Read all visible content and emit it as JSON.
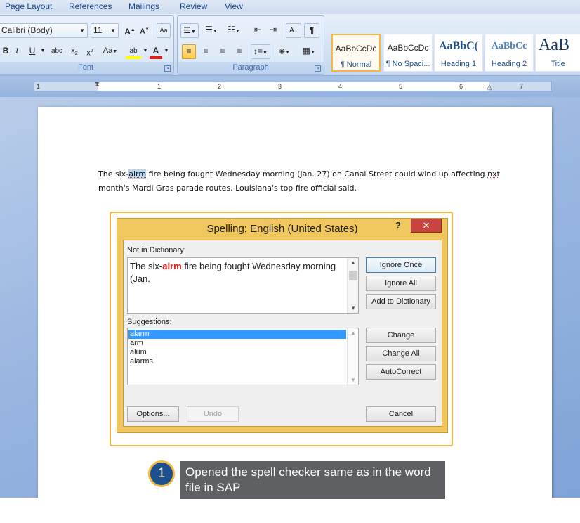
{
  "ribbon": {
    "tabs": [
      "Page Layout",
      "References",
      "Mailings",
      "Review",
      "View"
    ],
    "font": {
      "name": "Calibri (Body)",
      "size": "11",
      "group_label": "Font"
    },
    "paragraph": {
      "group_label": "Paragraph"
    },
    "styles": [
      {
        "sample": "AaBbCcDc",
        "name": "¶ Normal"
      },
      {
        "sample": "AaBbCcDc",
        "name": "¶ No Spaci..."
      },
      {
        "sample": "AaBbC(",
        "name": "Heading 1"
      },
      {
        "sample": "AaBbCc",
        "name": "Heading 2"
      },
      {
        "sample": "AaB",
        "name": "Title"
      }
    ]
  },
  "ruler": {
    "numbers": [
      "1",
      "1",
      "2",
      "3",
      "4",
      "5",
      "6",
      "7"
    ]
  },
  "document": {
    "text_before": "The six-",
    "misspelled": "alrm",
    "text_middle": " fire being fought Wednesday morning (Jan. 27) on Canal Street could wind up affecting ",
    "misspelled2": "nxt",
    "text_after": " month's Mardi Gras parade routes, Louisiana's top fire official said."
  },
  "dialog": {
    "title": "Spelling: English (United States)",
    "help": "?",
    "close": "✕",
    "not_in_dictionary_label": "Not in Dictionary:",
    "context_before": "The six-",
    "context_error": "alrm",
    "context_after": " fire being fought Wednesday morning (Jan.",
    "suggestions_label": "Suggestions:",
    "suggestions": [
      "alarm",
      "arm",
      "alum",
      "alarms"
    ],
    "buttons": {
      "ignore_once": "Ignore Once",
      "ignore_all": "Ignore All",
      "add_to_dictionary": "Add to Dictionary",
      "change": "Change",
      "change_all": "Change All",
      "autocorrect": "AutoCorrect",
      "options": "Options...",
      "undo": "Undo",
      "cancel": "Cancel"
    }
  },
  "caption": {
    "step": "1",
    "text": "Opened the spell checker same as in the word file in SAP"
  },
  "colors": {
    "dialog_frame": "#f0c75e",
    "highlight": "#f3b83f",
    "error_text": "#e0201b",
    "selection": "#3399ff",
    "caption_bg": "#5f6064",
    "badge": "#1e4f8f"
  }
}
